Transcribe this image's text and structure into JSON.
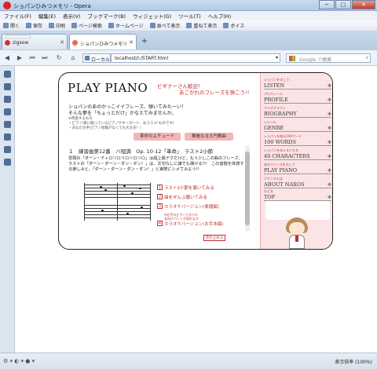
{
  "window": {
    "title": "ショパンひみつメモリ - Opera",
    "buttons": [
      "─",
      "□",
      "✕"
    ]
  },
  "menu": [
    "ファイル(F)",
    "編集(E)",
    "表示(V)",
    "ブックマーク(B)",
    "ウィジェット(G)",
    "ツール(T)",
    "ヘルプ(H)"
  ],
  "toolbar": [
    "開く",
    "保存",
    "印刷",
    "ページ検索",
    "ホームページ",
    "並べて表示",
    "重ねて表示",
    "ボイス"
  ],
  "tabs": [
    {
      "label": "zigsow",
      "favicon_color": "#d03030"
    },
    {
      "label": "ショパンひみつメモリ",
      "favicon_color": "#e07050"
    }
  ],
  "addressbar": {
    "local_label": "ローカル",
    "url": "localhost/I:/START.html",
    "search_placeholder": "Google で検索"
  },
  "page": {
    "logo": "PLAY PIANO",
    "welcome1": "ビギナーさん歓迎！",
    "welcome2": "あこがれのフレーズを弾こう!!",
    "intro1": "ショパンのあのかっこイイフレーズ、弾いてみたーい！",
    "intro2": "そんな夢を「ちょっとだけ」かなえてみませんか。",
    "note": "※用意するもの\n・ピアノ(家に眠っているピアノやキーボード、おススメ!ものです)\n・あなたの手(ピアノ経験がなくても大丈夫！)",
    "button1": "革命のエチュード",
    "button2": "華麗なる大円舞曲",
    "piece_title": "１　練習曲第12番　ハ短調　Op. 10-12「革命」　ラスト2小節",
    "description": "冒頭の「ダーン・ティロリロリロリロリロ」は超上級テクだけど、もう少しこの曲のフレーズ、ラストの「ダーン・ダーン・ダン・ダン！」は、文句なしに誰でも弾ける!!!　この音階を体感する楽しみと、「ダーン・ダーン・ダン・ダン！」と実際にシメてみよう!!",
    "links": [
      {
        "num": "1",
        "label": "ラスト2小節を聴いてみる"
      },
      {
        "num": "2",
        "label": "曲をぜんぶ聴いてみる"
      },
      {
        "num": "3",
        "label": "カラオケバージョン(楽譜編)"
      },
      {
        "num": "4",
        "label": "カラオケバージョン(お手本編)"
      }
    ],
    "sublink": "※右手のピアノとなりの\n右向けパートが流れます",
    "stop_label": "音を止める"
  },
  "sidebar": [
    {
      "jp": "ショパンをきこう",
      "en": "LISTEN"
    },
    {
      "jp": "プロフィール",
      "en": "PROFILE"
    },
    {
      "jp": "バイオグラフィ",
      "en": "BIOGRAPHY"
    },
    {
      "jp": "ジャンル",
      "en": "GENRE"
    },
    {
      "jp": "ショパンを知る100ワード",
      "en": "100 WORDS"
    },
    {
      "jp": "ショパンをめぐる人たち",
      "en": "40 CHARACTERS"
    },
    {
      "jp": "あのフレーズをひこう",
      "en": "PLAY PIANO"
    },
    {
      "jp": "ナクソスとは",
      "en": "ABOUT  NAXOS"
    },
    {
      "jp": "もどる",
      "en": "TOP"
    }
  ],
  "status": {
    "zoom": "表示倍率 (100%)"
  }
}
